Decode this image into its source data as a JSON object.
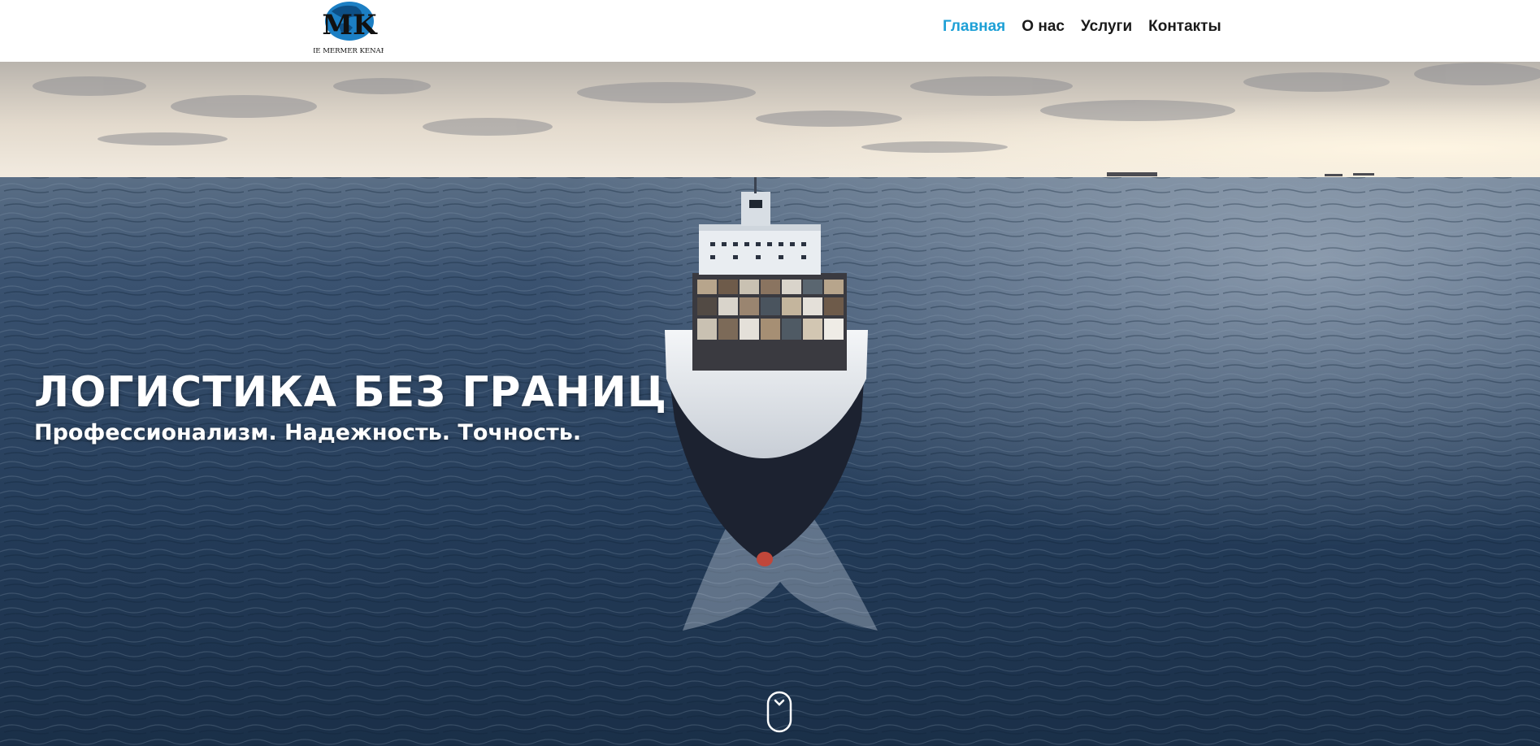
{
  "header": {
    "logo": {
      "name": "logo",
      "text": "IE MERMER KENAR",
      "mark": "MK"
    },
    "nav": [
      {
        "label": "Главная",
        "active": true
      },
      {
        "label": "О нас",
        "active": false
      },
      {
        "label": "Услуги",
        "active": false
      },
      {
        "label": "Контакты",
        "active": false
      }
    ]
  },
  "hero": {
    "title": "ЛОГИСТИКА БЕЗ ГРАНИЦ",
    "subtitle": "Профессионализм. Надежность. Точность.",
    "scroll_icon": "mouse-scroll-icon"
  },
  "colors": {
    "accent": "#1ea0d6",
    "nav_text": "#1a1a1a",
    "sea_dark": "#1f3550",
    "sky_light": "#e8e0d4"
  }
}
